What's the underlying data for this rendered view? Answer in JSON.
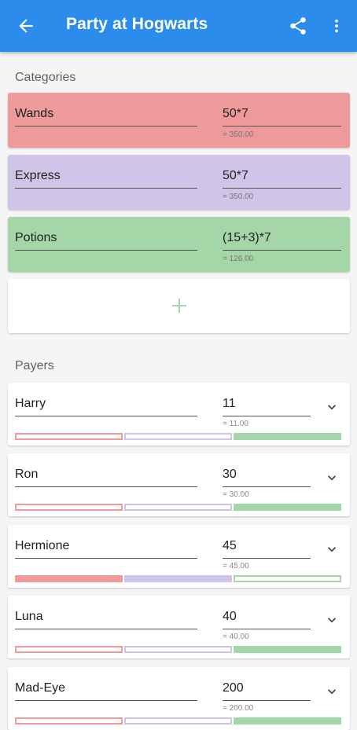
{
  "appbar": {
    "title": "Party at Hogwarts",
    "back_icon": "arrow-left-icon",
    "share_icon": "share-icon",
    "more_icon": "more-vertical-icon",
    "color": "#2b8cec"
  },
  "categories_label": "Categories",
  "categories": [
    {
      "name": "Wands",
      "expression": "50*7",
      "computed": "= 350.00",
      "color": "#ef9a9a"
    },
    {
      "name": "Express",
      "expression": "50*7",
      "computed": "= 350.00",
      "color": "#d1c4e9"
    },
    {
      "name": "Potions",
      "expression": "(15+3)*7",
      "computed": "= 126.00",
      "color": "#a5d6a7"
    }
  ],
  "add_category_icon": "plus-icon",
  "payers_label": "Payers",
  "payers": [
    {
      "name": "Harry",
      "amount": "11",
      "computed": "= 11.00",
      "selected": [
        false,
        false,
        true
      ]
    },
    {
      "name": "Ron",
      "amount": "30",
      "computed": "= 30.00",
      "selected": [
        false,
        false,
        true
      ]
    },
    {
      "name": "Hermione",
      "amount": "45",
      "computed": "= 45.00",
      "selected": [
        true,
        true,
        false
      ]
    },
    {
      "name": "Luna",
      "amount": "40",
      "computed": "= 40.00",
      "selected": [
        false,
        false,
        true
      ]
    },
    {
      "name": "Mad-Eye",
      "amount": "200",
      "computed": "= 200.00",
      "selected": [
        false,
        false,
        true
      ]
    }
  ],
  "chevron_icon": "chevron-down-icon"
}
